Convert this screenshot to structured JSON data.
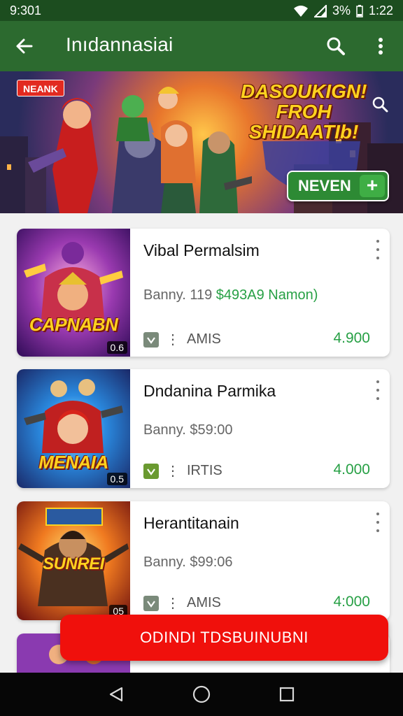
{
  "status_bar": {
    "time": "9:301",
    "battery": "3%",
    "clock": "1:22"
  },
  "app_bar": {
    "title": "Inıdannasiai"
  },
  "banner": {
    "badge": "NEANK",
    "headline": "DASOUKIGN! FROH SHIDAATIb!",
    "cta_label": "NEVEN"
  },
  "cards": [
    {
      "title": "Vibal Permalsim",
      "meta_label": "Banny. 119",
      "meta_price": "$493A9 Namon)",
      "foot_label": "AMIS",
      "count": "4.900",
      "thumb_title": "CAPNABN",
      "thumb_sub": "",
      "thumb_tag": "0.6"
    },
    {
      "title": "Dndanina Parmika",
      "meta_label": "Banny. $59:00",
      "meta_price": "",
      "foot_label": "IRTIS",
      "count": "4.000",
      "thumb_title": "MENAIA",
      "thumb_sub": "",
      "thumb_tag": "0.5"
    },
    {
      "title": "Herantitanain",
      "meta_label": "Banny. $99:06",
      "meta_price": "",
      "foot_label": "AMIS",
      "count": "4:000",
      "thumb_title": "SUNREI",
      "thumb_sub": "",
      "thumb_tag": "05"
    }
  ],
  "float_button": {
    "label": "ODINDI TDSBUINUBNI"
  },
  "colors": {
    "app_bar": "#2c6a2f",
    "status_bar": "#1c4d1f",
    "accent_green": "#27a045",
    "float_red": "#f0100c"
  }
}
